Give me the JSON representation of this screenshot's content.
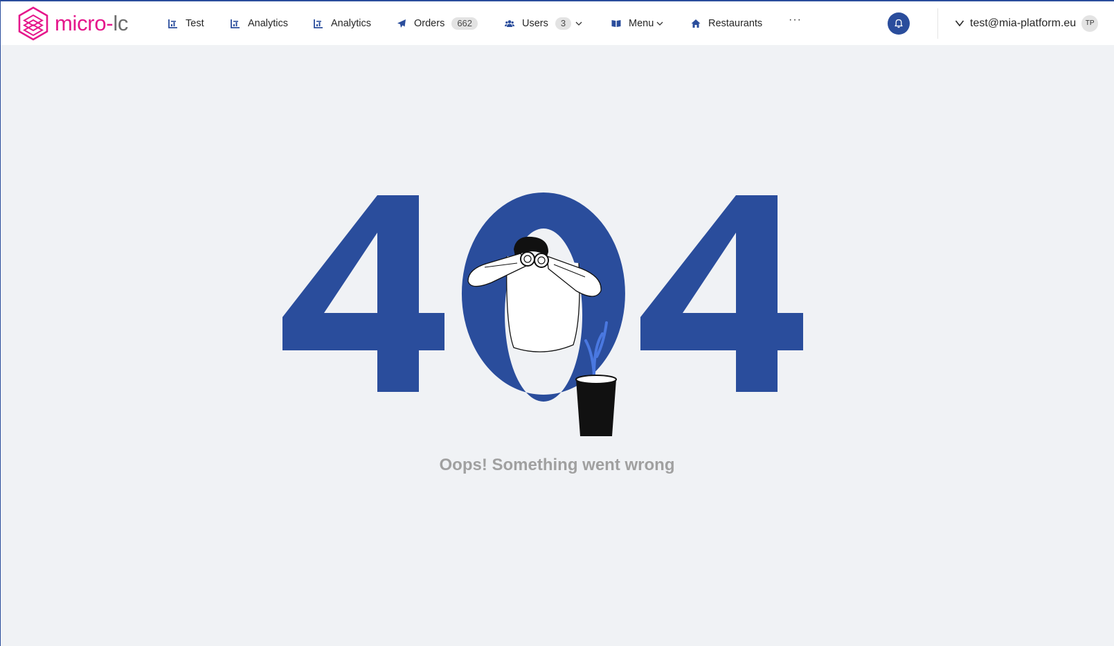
{
  "header": {
    "logo": {
      "brand": "micro",
      "dash": "-",
      "suffix": "lc",
      "icon": "hexagon-logo-icon"
    },
    "nav": [
      {
        "label": "Test",
        "icon": "chart-icon"
      },
      {
        "label": "Analytics",
        "icon": "chart-icon"
      },
      {
        "label": "Analytics",
        "icon": "chart-icon"
      },
      {
        "label": "Orders",
        "icon": "paper-plane-icon",
        "badge": "662"
      },
      {
        "label": "Users",
        "icon": "users-icon",
        "badge": "3",
        "dropdown": true
      },
      {
        "label": "Menu",
        "icon": "book-icon",
        "dropdown": true
      },
      {
        "label": "Restaurants",
        "icon": "home-icon"
      }
    ],
    "more_label": "···",
    "notifications_icon": "bell-icon",
    "user": {
      "email": "test@mia-platform.eu",
      "initials": "TP"
    }
  },
  "error": {
    "code": "404",
    "message": "Oops! Something went wrong"
  },
  "colors": {
    "accent": "#2a4d9c",
    "brand": "#e5168b",
    "background": "#f0f2f5",
    "message": "#a0a0a0",
    "plant": "#4a78e0"
  }
}
